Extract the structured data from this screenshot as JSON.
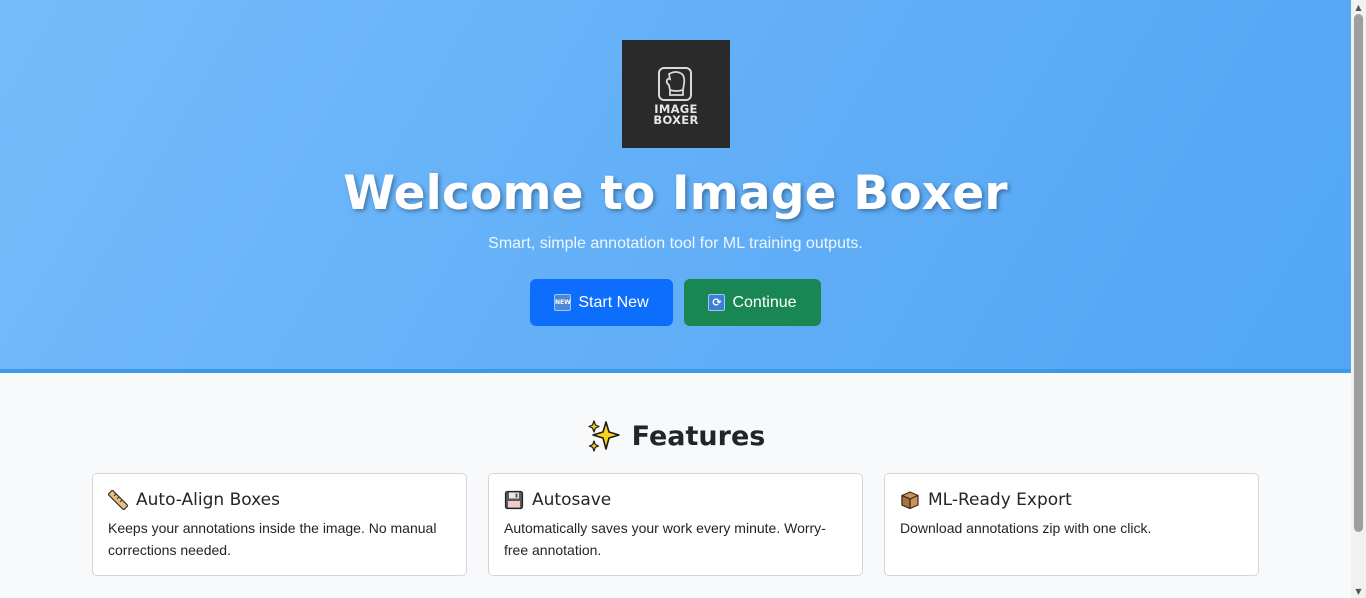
{
  "hero": {
    "logo_line1": "IMAGE",
    "logo_line2": "BOXER",
    "title": "Welcome to Image Boxer",
    "subtitle": "Smart, simple annotation tool for ML training outputs.",
    "start_button": {
      "icon_text": "NEW",
      "label": "Start New"
    },
    "continue_button": {
      "icon_text": "⟳",
      "label": "Continue"
    }
  },
  "features": {
    "heading": "Features",
    "cards": [
      {
        "icon": "ruler-icon",
        "title": "Auto-Align Boxes",
        "text": "Keeps your annotations inside the image. No manual corrections needed."
      },
      {
        "icon": "floppy-disk-icon",
        "title": "Autosave",
        "text": "Automatically saves your work every minute. Worry-free annotation."
      },
      {
        "icon": "package-icon",
        "title": "ML-Ready Export",
        "text": "Download annotations zip with one click."
      }
    ]
  },
  "colors": {
    "hero_gradient_start": "#74bcfb",
    "hero_gradient_end": "#52a6f4",
    "start_button": "#0d6efd",
    "continue_button": "#198754",
    "logo_bg": "#2a2a2a"
  }
}
